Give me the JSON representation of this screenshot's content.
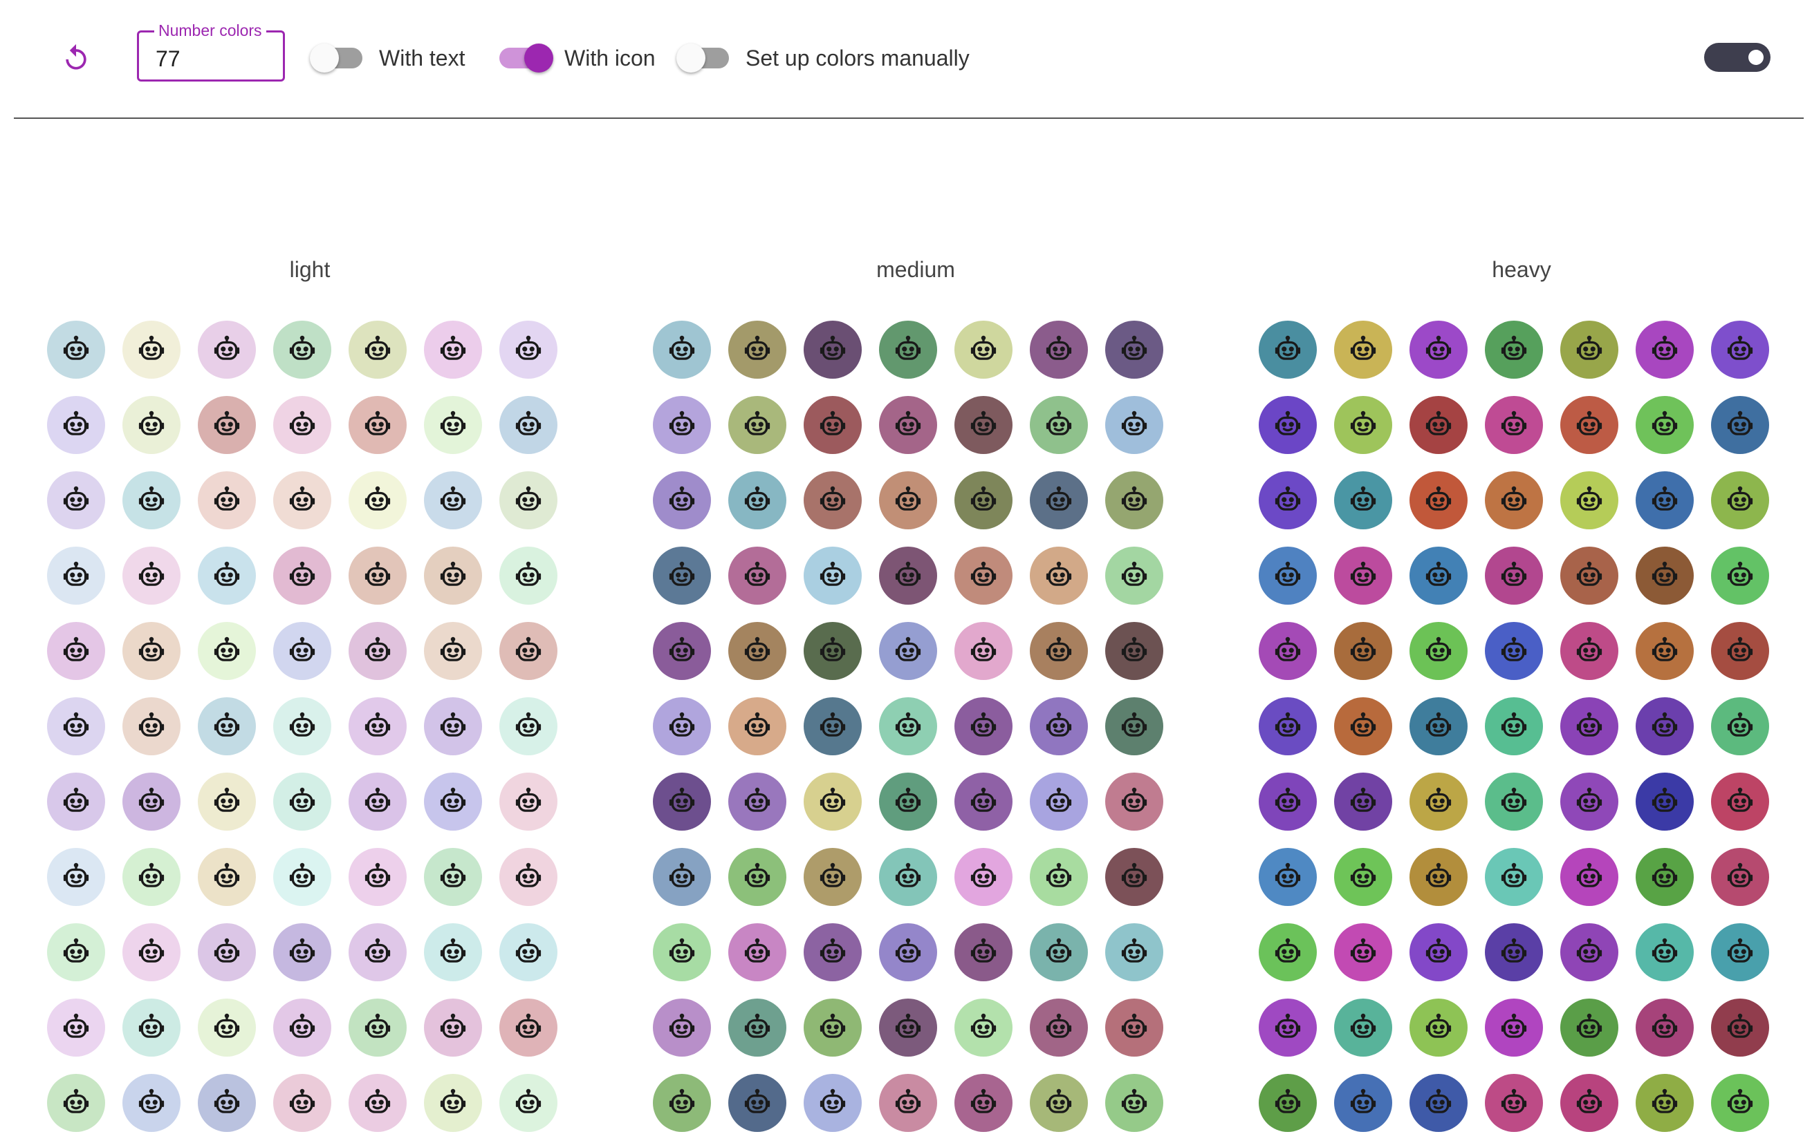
{
  "toolbar": {
    "reset_icon": "refresh-icon",
    "number_field": {
      "label": "Number colors",
      "value": "77"
    },
    "switches": [
      {
        "label": "With text",
        "checked": false
      },
      {
        "label": "With icon",
        "checked": true
      },
      {
        "label": "Set up colors manually",
        "checked": false
      }
    ],
    "theme_toggle": {
      "state": "dark"
    },
    "accent_color": "#9c27b0"
  },
  "palettes": [
    {
      "title": "light",
      "icon": "robot-icon",
      "icon_color": "#1a1a1a",
      "colors": [
        "#c2dbe3",
        "#f1efd9",
        "#e8cfe8",
        "#bfe0c6",
        "#dde3be",
        "#eccdeb",
        "#e3d6f2",
        "#dcd6f2",
        "#eaf0d7",
        "#d9b0ae",
        "#efd3e4",
        "#e0b9b3",
        "#e3f4d9",
        "#c1d6e6",
        "#ddd4ef",
        "#c6e2e6",
        "#efd7d1",
        "#f0dcd4",
        "#f2f5da",
        "#c9dbea",
        "#dfead3",
        "#dbe6f2",
        "#f0d8ea",
        "#c9e2ec",
        "#e2bad2",
        "#e2c5b9",
        "#e4cfbf",
        "#d9f2df",
        "#e4c6e6",
        "#ebd8c9",
        "#e5f5d9",
        "#d1d6ef",
        "#e0c2dd",
        "#ebd9cc",
        "#dfbcb6",
        "#dcd5f0",
        "#ebd8cd",
        "#c2dbe4",
        "#d9f1eb",
        "#e1c9ea",
        "#d2c3e8",
        "#d7f1e8",
        "#d8c8ea",
        "#cdb6e0",
        "#eeebd0",
        "#d3efe6",
        "#dac3e8",
        "#c7c5ec",
        "#f0d5df",
        "#dbe7f3",
        "#d5f0d2",
        "#ece2c8",
        "#dbf4f1",
        "#edd0eb",
        "#c6e7cc",
        "#f0d4df",
        "#d4f0d6",
        "#eed4ec",
        "#dbc6e6",
        "#c5b8e0",
        "#dfc7e8",
        "#cdebea",
        "#cce9ec",
        "#ebd5f0",
        "#cdebe4",
        "#e6f3d8",
        "#e3c8e7",
        "#c2e3c1",
        "#e4c2dc",
        "#dfb3b7",
        "#c8e6c4",
        "#c9d4ec",
        "#bac2df",
        "#ebcbd9",
        "#ebcce2",
        "#e4efcf",
        "#dcf3de"
      ]
    },
    {
      "title": "medium",
      "icon": "robot-icon",
      "icon_color": "#1a1a1a",
      "colors": [
        "#9fc5d2",
        "#a39a6a",
        "#6a4f73",
        "#62986e",
        "#cfd79e",
        "#8b5c8c",
        "#6b5a85",
        "#b4a4dc",
        "#a9b87b",
        "#9c5a5d",
        "#a46589",
        "#7e5a5e",
        "#8fc18c",
        "#9fbedb",
        "#9f8ccb",
        "#87b7c3",
        "#a8736a",
        "#c18f76",
        "#7e865a",
        "#5c7088",
        "#95a670",
        "#5c7996",
        "#b36d98",
        "#aacfe1",
        "#7d5574",
        "#c08b7b",
        "#d2a988",
        "#a3d6a2",
        "#8a5c9a",
        "#a4845f",
        "#596c4e",
        "#959ed1",
        "#e2a8cd",
        "#a8805f",
        "#6c5252",
        "#b0a5dd",
        "#d7aa8a",
        "#56788e",
        "#8ecfb2",
        "#8b5d9e",
        "#9076c0",
        "#5d806e",
        "#6d4f8e",
        "#9977bd",
        "#d7d08f",
        "#609d7e",
        "#8f61a6",
        "#a8a4e0",
        "#c07c90",
        "#86a2c2",
        "#8cc07a",
        "#ae9c6a",
        "#83c5b8",
        "#e2a6df",
        "#a8dca0",
        "#7c5158",
        "#a7dca4",
        "#c886c4",
        "#8c63a2",
        "#9486ca",
        "#8a5a8a",
        "#7ab3ac",
        "#8fc4cb",
        "#b88fc9",
        "#6ea08f",
        "#8fb874",
        "#7c5a7c",
        "#b3e1ac",
        "#a16587",
        "#b5707a",
        "#8dba78",
        "#536a8b",
        "#a9b3e0",
        "#c98ba2",
        "#a86590",
        "#a6b878",
        "#95ca89"
      ]
    },
    {
      "title": "heavy",
      "icon": "robot-icon",
      "icon_color": "#1a1a1a",
      "colors": [
        "#4a8ea0",
        "#c9b456",
        "#9c49c8",
        "#56a05c",
        "#98a64a",
        "#a847c0",
        "#7e4fcc",
        "#6b46c6",
        "#9ec45b",
        "#a54343",
        "#bf4b94",
        "#bd5b45",
        "#6fc25a",
        "#3f6fa0",
        "#6c49c6",
        "#4a96a4",
        "#c1583a",
        "#be7444",
        "#b5cc58",
        "#3f6fab",
        "#8db64d",
        "#4f82c1",
        "#bc4b9e",
        "#4281b5",
        "#b2478f",
        "#a8634a",
        "#8c5a36",
        "#63c266",
        "#a44ab6",
        "#a86c3c",
        "#6cc256",
        "#4a5fc6",
        "#be4b88",
        "#b6713f",
        "#a54d41",
        "#6a4cc2",
        "#b86a3c",
        "#3f7d9c",
        "#57be92",
        "#8a43b6",
        "#6b3fad",
        "#5cba7e",
        "#7f45ba",
        "#7142a4",
        "#bca646",
        "#5bbd8b",
        "#8f48b8",
        "#3b3aa6",
        "#bd4465",
        "#4f89c3",
        "#6ec458",
        "#b28e3c",
        "#6ac7b6",
        "#b545bb",
        "#58a345",
        "#b64a6f",
        "#6bc25a",
        "#c24ab3",
        "#8348c8",
        "#5a3fa6",
        "#8f45b6",
        "#56b8a8",
        "#49a0ac",
        "#9f49c2",
        "#58b39a",
        "#8ec355",
        "#b045c0",
        "#5a9e48",
        "#a6437a",
        "#913d4d",
        "#5e9e48",
        "#4670b5",
        "#3f5aa8",
        "#bd4b86",
        "#b8437e",
        "#8fad45",
        "#6bc25a"
      ]
    }
  ]
}
